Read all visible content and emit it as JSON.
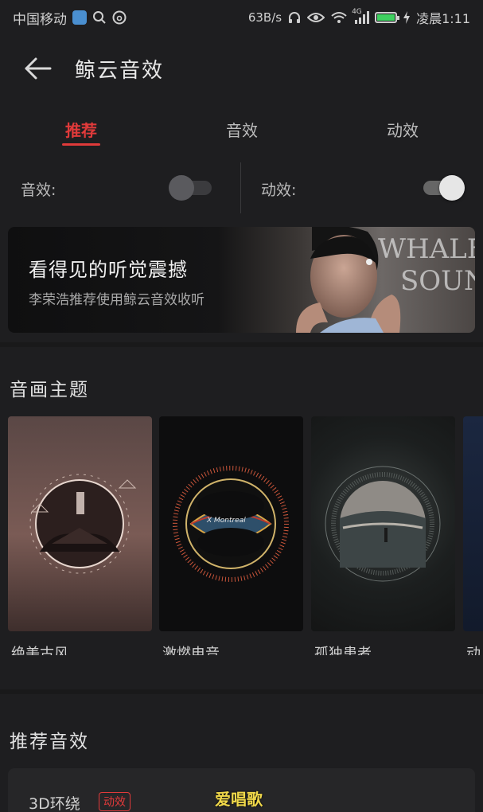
{
  "status_bar": {
    "carrier": "中国移动",
    "net_speed": "63B/s",
    "signal_tag": "4G",
    "time": "凌晨1:11"
  },
  "header": {
    "title": "鲸云音效"
  },
  "tabs": [
    {
      "label": "推荐",
      "active": true
    },
    {
      "label": "音效",
      "active": false
    },
    {
      "label": "动效",
      "active": false
    }
  ],
  "toggles": {
    "sound": {
      "label": "音效:",
      "state": "off"
    },
    "motion": {
      "label": "动效:",
      "state": "on"
    }
  },
  "banner": {
    "title": "看得见的听觉震撼",
    "subtitle": "李荣浩推荐使用鲸云音效收听",
    "wordmark_line1": "WHALE CLOUD",
    "wordmark_line2": "SOUND EFFECT"
  },
  "themes_section": {
    "title": "音画主题",
    "items": [
      {
        "name": "绝美古风"
      },
      {
        "name": "激燃电音",
        "art_text": "X Montreal"
      },
      {
        "name": "孤独患者"
      },
      {
        "name": "动"
      }
    ]
  },
  "recommend_section": {
    "title": "推荐音效",
    "items": [
      {
        "name": "3D环绕",
        "badge": "动效"
      }
    ]
  },
  "watermark": "爱唱歌",
  "colors": {
    "accent": "#e03a3a",
    "background": "#1e1e20"
  }
}
